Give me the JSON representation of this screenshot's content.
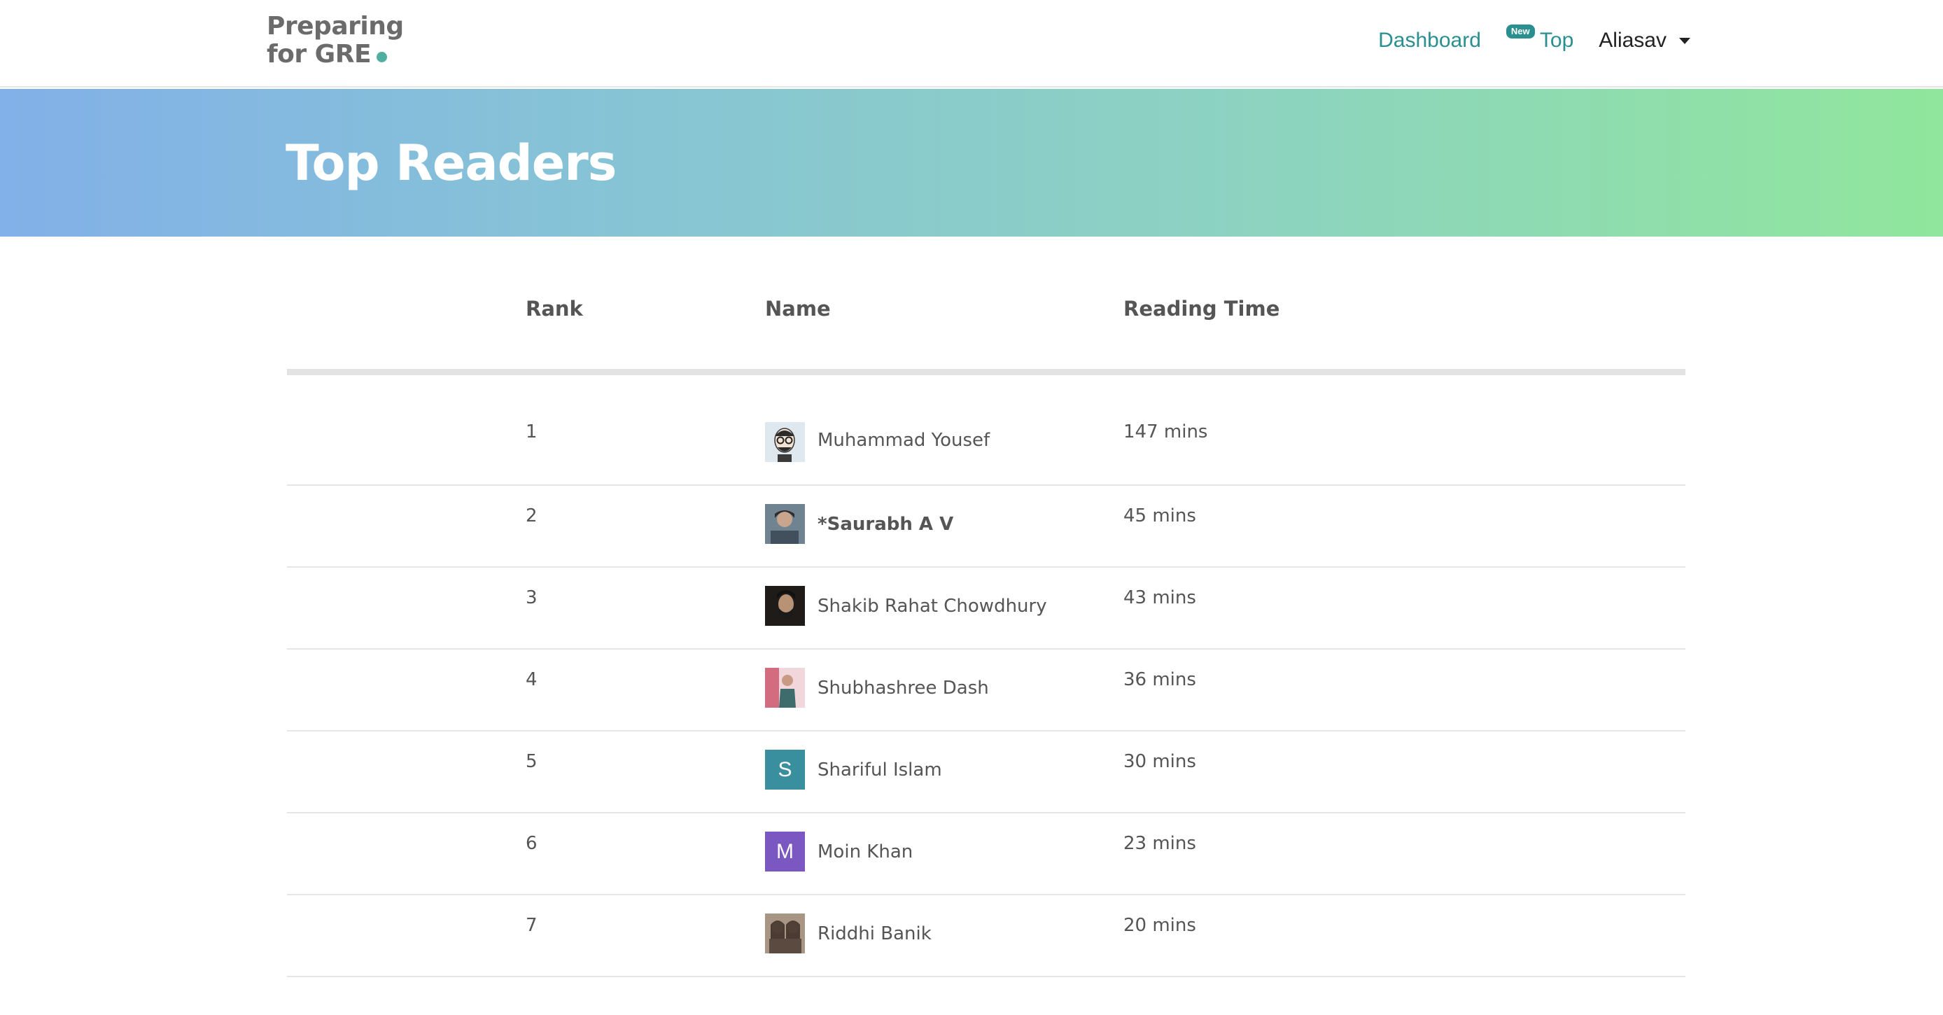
{
  "logo": {
    "line1": "Preparing",
    "line2": "for GRE"
  },
  "nav": {
    "dashboard": "Dashboard",
    "new_badge": "New",
    "top": "Top",
    "user": "Aliasav"
  },
  "banner": {
    "title": "Top Readers"
  },
  "table": {
    "headers": {
      "rank": "Rank",
      "name": "Name",
      "time": "Reading Time"
    },
    "rows": [
      {
        "rank": "1",
        "name": "Muhammad Yousef",
        "time": "147 mins",
        "avatar_letter": "",
        "avatar_color": "#cfd9df"
      },
      {
        "rank": "2",
        "name": "*Saurabh A V",
        "time": "45 mins",
        "avatar_letter": "",
        "avatar_color": "#5a6b78"
      },
      {
        "rank": "3",
        "name": "Shakib Rahat Chowdhury",
        "time": "43 mins",
        "avatar_letter": "",
        "avatar_color": "#2b2622"
      },
      {
        "rank": "4",
        "name": "Shubhashree Dash",
        "time": "36 mins",
        "avatar_letter": "",
        "avatar_color": "#d98a97"
      },
      {
        "rank": "5",
        "name": "Shariful Islam",
        "time": "30 mins",
        "avatar_letter": "S",
        "avatar_color": "#3a8f9f"
      },
      {
        "rank": "6",
        "name": "Moin Khan",
        "time": "23 mins",
        "avatar_letter": "M",
        "avatar_color": "#7b57c2"
      },
      {
        "rank": "7",
        "name": "Riddhi Banik",
        "time": "20 mins",
        "avatar_letter": "",
        "avatar_color": "#6b5a4e"
      }
    ]
  },
  "colors": {
    "accent": "#2a8f8f",
    "logo_dot": "#4fae9e",
    "banner_start": "#82b0e8",
    "banner_end": "#90e69c"
  }
}
